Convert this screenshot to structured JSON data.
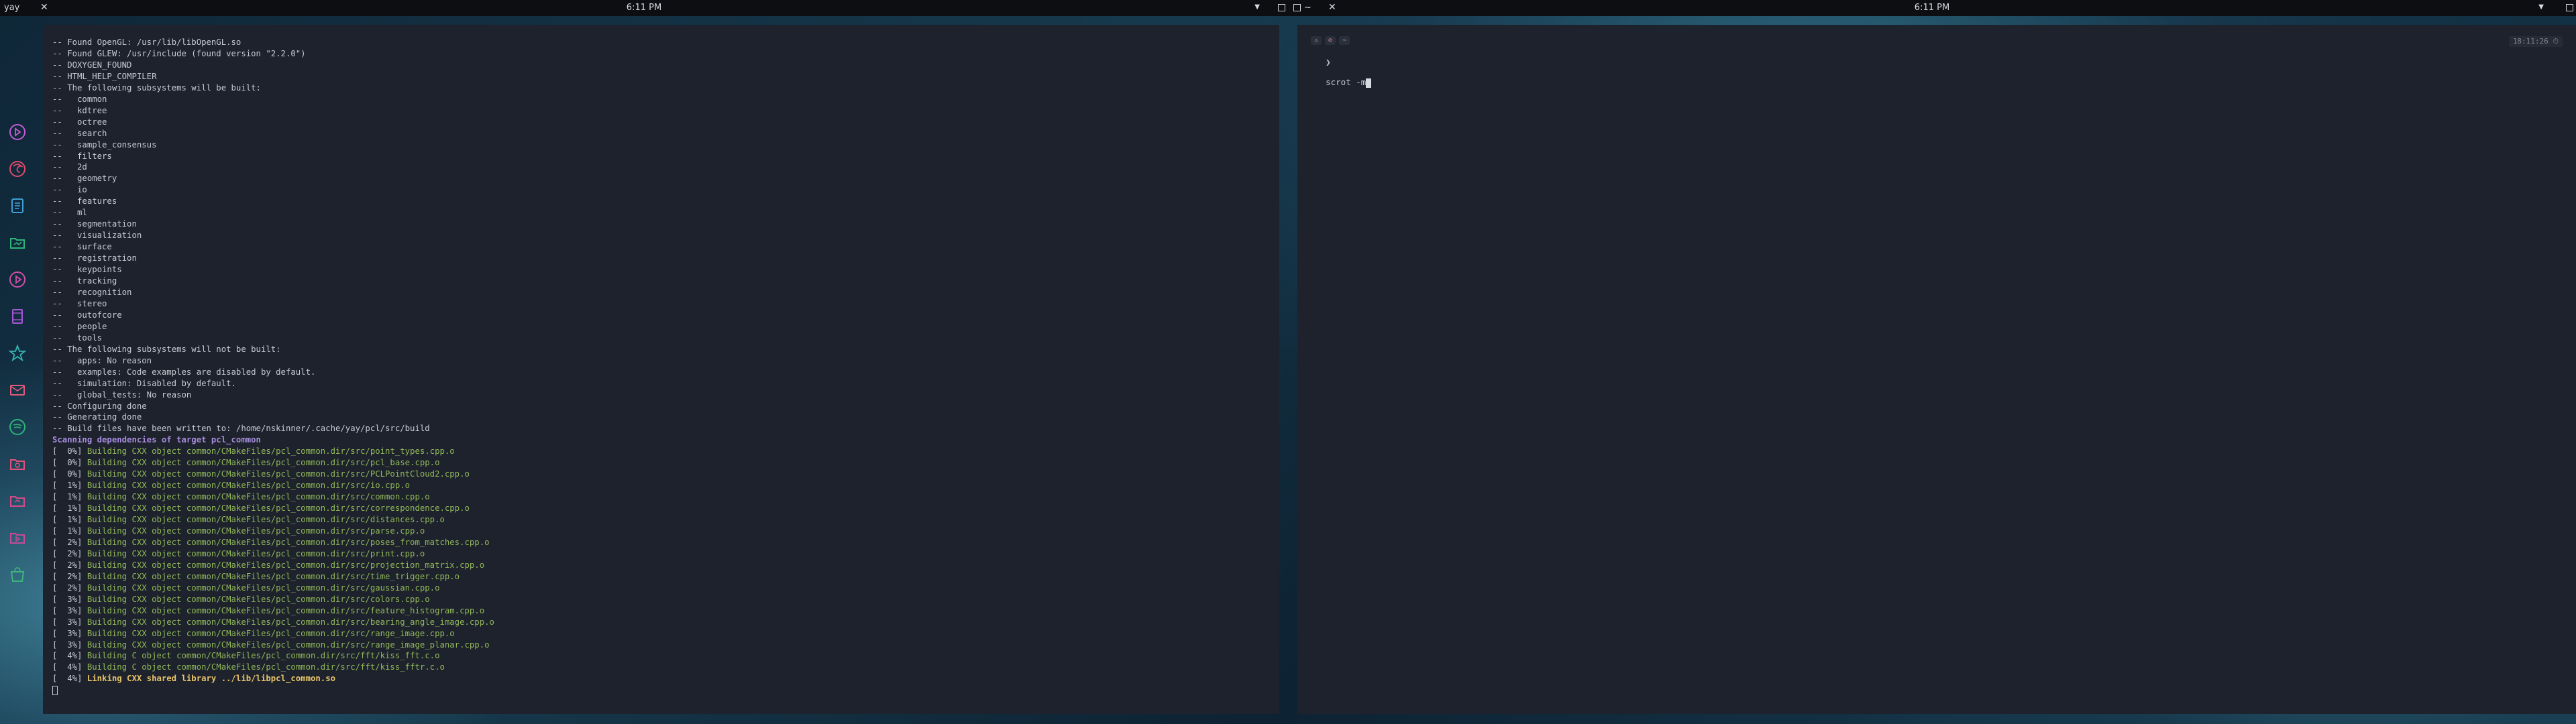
{
  "left_bar": {
    "title": "yay",
    "clock": "6:11 PM"
  },
  "right_bar": {
    "title": "~",
    "clock": "6:11 PM"
  },
  "dock": {
    "items": [
      {
        "icon": "music-player-icon",
        "color": "#c65bd6"
      },
      {
        "icon": "firefox-icon",
        "color": "#e04a6a"
      },
      {
        "icon": "text-editor-icon",
        "color": "#3f9fd6"
      },
      {
        "icon": "files-icon",
        "color": "#2fb47a"
      },
      {
        "icon": "media-player-icon",
        "color": "#d04fa8"
      },
      {
        "icon": "film-icon",
        "color": "#a856d6"
      },
      {
        "icon": "star-icon",
        "color": "#37b3b0"
      },
      {
        "icon": "mail-icon",
        "color": "#e05a7a"
      },
      {
        "icon": "spotify-icon",
        "color": "#2fb47a"
      },
      {
        "icon": "camera-folder-icon",
        "color": "#e0527a"
      },
      {
        "icon": "folder-icon",
        "color": "#d64a8a"
      },
      {
        "icon": "video-folder-icon",
        "color": "#c84a9a"
      },
      {
        "icon": "store-icon",
        "color": "#3fb47a"
      }
    ]
  },
  "left_terminal": {
    "lines": [
      {
        "type": "plain",
        "text": "-- Found OpenGL: /usr/lib/libOpenGL.so"
      },
      {
        "type": "plain",
        "text": "-- Found GLEW: /usr/include (found version \"2.2.0\")"
      },
      {
        "type": "plain",
        "text": "-- DOXYGEN_FOUND"
      },
      {
        "type": "plain",
        "text": "-- HTML_HELP_COMPILER"
      },
      {
        "type": "plain",
        "text": "-- The following subsystems will be built:"
      },
      {
        "type": "plain",
        "text": "--   common"
      },
      {
        "type": "plain",
        "text": "--   kdtree"
      },
      {
        "type": "plain",
        "text": "--   octree"
      },
      {
        "type": "plain",
        "text": "--   search"
      },
      {
        "type": "plain",
        "text": "--   sample_consensus"
      },
      {
        "type": "plain",
        "text": "--   filters"
      },
      {
        "type": "plain",
        "text": "--   2d"
      },
      {
        "type": "plain",
        "text": "--   geometry"
      },
      {
        "type": "plain",
        "text": "--   io"
      },
      {
        "type": "plain",
        "text": "--   features"
      },
      {
        "type": "plain",
        "text": "--   ml"
      },
      {
        "type": "plain",
        "text": "--   segmentation"
      },
      {
        "type": "plain",
        "text": "--   visualization"
      },
      {
        "type": "plain",
        "text": "--   surface"
      },
      {
        "type": "plain",
        "text": "--   registration"
      },
      {
        "type": "plain",
        "text": "--   keypoints"
      },
      {
        "type": "plain",
        "text": "--   tracking"
      },
      {
        "type": "plain",
        "text": "--   recognition"
      },
      {
        "type": "plain",
        "text": "--   stereo"
      },
      {
        "type": "plain",
        "text": "--   outofcore"
      },
      {
        "type": "plain",
        "text": "--   people"
      },
      {
        "type": "plain",
        "text": "--   tools"
      },
      {
        "type": "plain",
        "text": "-- The following subsystems will not be built:"
      },
      {
        "type": "plain",
        "text": "--   apps: No reason"
      },
      {
        "type": "plain",
        "text": "--   examples: Code examples are disabled by default."
      },
      {
        "type": "plain",
        "text": "--   simulation: Disabled by default."
      },
      {
        "type": "plain",
        "text": "--   global_tests: No reason"
      },
      {
        "type": "plain",
        "text": "-- Configuring done"
      },
      {
        "type": "plain",
        "text": "-- Generating done"
      },
      {
        "type": "plain",
        "text": "-- Build files have been written to: /home/nskinner/.cache/yay/pcl/src/build"
      },
      {
        "type": "scan",
        "text": "Scanning dependencies of target pcl_common"
      },
      {
        "type": "build",
        "pct": "[  0%] ",
        "text": "Building CXX object common/CMakeFiles/pcl_common.dir/src/point_types.cpp.o"
      },
      {
        "type": "build",
        "pct": "[  0%] ",
        "text": "Building CXX object common/CMakeFiles/pcl_common.dir/src/pcl_base.cpp.o"
      },
      {
        "type": "build",
        "pct": "[  0%] ",
        "text": "Building CXX object common/CMakeFiles/pcl_common.dir/src/PCLPointCloud2.cpp.o"
      },
      {
        "type": "build",
        "pct": "[  1%] ",
        "text": "Building CXX object common/CMakeFiles/pcl_common.dir/src/io.cpp.o"
      },
      {
        "type": "build",
        "pct": "[  1%] ",
        "text": "Building CXX object common/CMakeFiles/pcl_common.dir/src/common.cpp.o"
      },
      {
        "type": "build",
        "pct": "[  1%] ",
        "text": "Building CXX object common/CMakeFiles/pcl_common.dir/src/correspondence.cpp.o"
      },
      {
        "type": "build",
        "pct": "[  1%] ",
        "text": "Building CXX object common/CMakeFiles/pcl_common.dir/src/distances.cpp.o"
      },
      {
        "type": "build",
        "pct": "[  1%] ",
        "text": "Building CXX object common/CMakeFiles/pcl_common.dir/src/parse.cpp.o"
      },
      {
        "type": "build",
        "pct": "[  2%] ",
        "text": "Building CXX object common/CMakeFiles/pcl_common.dir/src/poses_from_matches.cpp.o"
      },
      {
        "type": "build",
        "pct": "[  2%] ",
        "text": "Building CXX object common/CMakeFiles/pcl_common.dir/src/print.cpp.o"
      },
      {
        "type": "build",
        "pct": "[  2%] ",
        "text": "Building CXX object common/CMakeFiles/pcl_common.dir/src/projection_matrix.cpp.o"
      },
      {
        "type": "build",
        "pct": "[  2%] ",
        "text": "Building CXX object common/CMakeFiles/pcl_common.dir/src/time_trigger.cpp.o"
      },
      {
        "type": "build",
        "pct": "[  2%] ",
        "text": "Building CXX object common/CMakeFiles/pcl_common.dir/src/gaussian.cpp.o"
      },
      {
        "type": "build",
        "pct": "[  3%] ",
        "text": "Building CXX object common/CMakeFiles/pcl_common.dir/src/colors.cpp.o"
      },
      {
        "type": "build",
        "pct": "[  3%] ",
        "text": "Building CXX object common/CMakeFiles/pcl_common.dir/src/feature_histogram.cpp.o"
      },
      {
        "type": "build",
        "pct": "[  3%] ",
        "text": "Building CXX object common/CMakeFiles/pcl_common.dir/src/bearing_angle_image.cpp.o"
      },
      {
        "type": "build",
        "pct": "[  3%] ",
        "text": "Building CXX object common/CMakeFiles/pcl_common.dir/src/range_image.cpp.o"
      },
      {
        "type": "build",
        "pct": "[  3%] ",
        "text": "Building CXX object common/CMakeFiles/pcl_common.dir/src/range_image_planar.cpp.o"
      },
      {
        "type": "build",
        "pct": "[  4%] ",
        "text": "Building C object common/CMakeFiles/pcl_common.dir/src/fft/kiss_fft.c.o"
      },
      {
        "type": "build",
        "pct": "[  4%] ",
        "text": "Building C object common/CMakeFiles/pcl_common.dir/src/fft/kiss_fftr.c.o"
      },
      {
        "type": "link",
        "pct": "[  4%] ",
        "text": "Linking CXX shared library ../lib/libpcl_common.so"
      }
    ]
  },
  "right_terminal": {
    "status_segments": [
      "⚠",
      "⊘",
      "~"
    ],
    "time": "18:11:26 ⏱",
    "prompt_symbol": "❯",
    "command": "scrot -m"
  },
  "colors": {
    "terminal_bg": "#1d222c",
    "text": "#c5cad3",
    "build_green": "#91b859",
    "scan_purple": "#a68cdc",
    "link_yellow": "#e8c46a"
  }
}
